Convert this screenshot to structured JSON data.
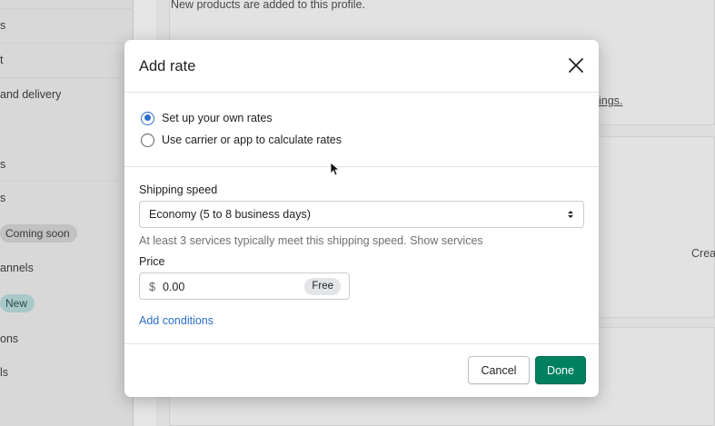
{
  "background": {
    "sidebar": {
      "items": [
        {
          "label": "s"
        },
        {
          "label": "t"
        },
        {
          "label": "and delivery"
        },
        {
          "label": "s"
        },
        {
          "label": "s"
        },
        {
          "label": "Coming soon",
          "badge": true
        },
        {
          "label": "annels"
        },
        {
          "label": "New",
          "badge": true
        },
        {
          "label": "ons"
        },
        {
          "label": "ls"
        }
      ]
    },
    "main": {
      "top_text": "New products are added to this profile.",
      "right_link_fragment": "ings.",
      "right_text_fragment": "Crea"
    }
  },
  "modal": {
    "title": "Add rate",
    "close_icon": "close-icon",
    "rate_options": [
      {
        "label": "Set up your own rates",
        "checked": true
      },
      {
        "label": "Use carrier or app to calculate rates",
        "checked": false
      }
    ],
    "shipping_speed": {
      "label": "Shipping speed",
      "value": "Economy (5 to 8 business days)",
      "help_prefix": "At least 3 services typically meet this shipping speed.",
      "help_link": "Show services"
    },
    "price": {
      "label": "Price",
      "prefix": "$",
      "value": "0.00",
      "badge": "Free"
    },
    "add_conditions": "Add conditions",
    "footer": {
      "cancel_label": "Cancel",
      "done_label": "Done"
    }
  },
  "colors": {
    "accent": "#2c6ecb",
    "primary_button": "#008060",
    "overlay_tint": "#dedede"
  }
}
